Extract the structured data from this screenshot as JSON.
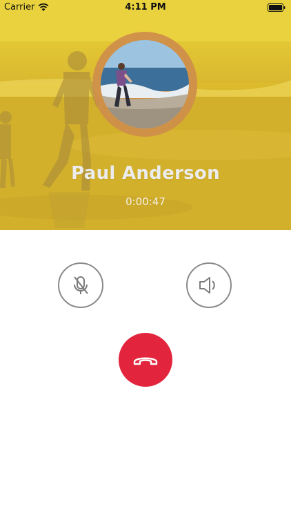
{
  "status_bar": {
    "carrier": "Carrier",
    "time": "4:11 PM",
    "icons": [
      "wifi-icon",
      "battery-icon"
    ]
  },
  "call": {
    "caller_name": "Paul Anderson",
    "duration": "0:00:47"
  },
  "controls": {
    "mute_icon": "microphone-muted-icon",
    "speaker_icon": "speaker-icon",
    "end_call_icon": "phone-hangup-icon"
  },
  "colors": {
    "hero_tint": "#e6c730",
    "avatar_ring": "#cf8f4a",
    "end_call": "#e2253d",
    "control_border": "#8a8a8a"
  }
}
